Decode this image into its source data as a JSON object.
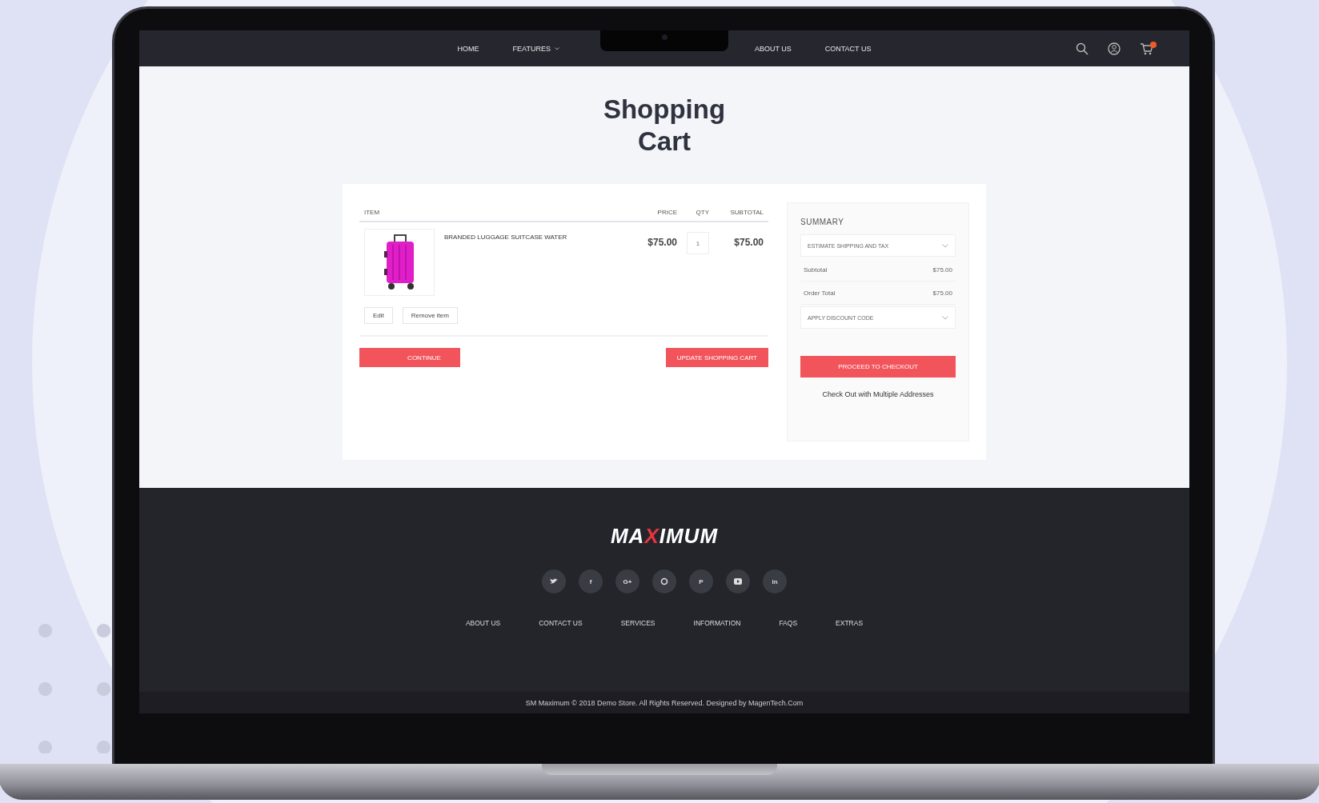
{
  "nav": {
    "links": [
      {
        "label": "HOME",
        "dropdown": false
      },
      {
        "label": "FEATURES",
        "dropdown": true
      },
      {
        "label": "ABOUT US",
        "dropdown": false
      },
      {
        "label": "CONTACT US",
        "dropdown": false
      }
    ]
  },
  "page_title": "Shopping Cart",
  "cart": {
    "columns": [
      "ITEM",
      "PRICE",
      "QTY",
      "SUBTOTAL"
    ],
    "items": [
      {
        "name": "BRANDED LUGGAGE SUITCASE WATER",
        "price": "$75.00",
        "qty": "1",
        "subtotal": "$75.00",
        "actions": [
          "Edit",
          "Remove item"
        ]
      }
    ],
    "continue_button": "CONTINUE",
    "update_button": "UPDATE SHOPPING CART"
  },
  "summary": {
    "title": "SUMMARY",
    "sections": [
      {
        "kind": "dropdown",
        "label": "ESTIMATE SHIPPING AND TAX"
      },
      {
        "kind": "row",
        "label": "Subtotal",
        "value": "$75.00"
      },
      {
        "kind": "row",
        "label": "Order Total",
        "value": "$75.00"
      },
      {
        "kind": "dropdown",
        "label": "APPLY DISCOUNT CODE"
      }
    ],
    "checkout_button": "PROCEED TO CHECKOUT",
    "multi_link": "Check Out with Multiple Addresses"
  },
  "footer": {
    "logo": [
      {
        "text": "MA",
        "accent": false
      },
      {
        "text": "X",
        "accent": true
      },
      {
        "text": "IMUM",
        "accent": false
      }
    ],
    "social": [
      {
        "kind": "bird"
      },
      {
        "kind": "glyph",
        "glyph": "f"
      },
      {
        "kind": "glyph",
        "glyph": "G+"
      },
      {
        "kind": "ring"
      },
      {
        "kind": "glyph",
        "glyph": "P"
      },
      {
        "kind": "play"
      },
      {
        "kind": "glyph",
        "glyph": "in"
      }
    ],
    "links": [
      "ABOUT US",
      "CONTACT US",
      "SERVICES",
      "INFORMATION",
      "FAQS",
      "EXTRAS"
    ],
    "copyright": "SM Maximum © 2018 Demo Store. All Rights Reserved. Designed by MagenTech.Com"
  }
}
